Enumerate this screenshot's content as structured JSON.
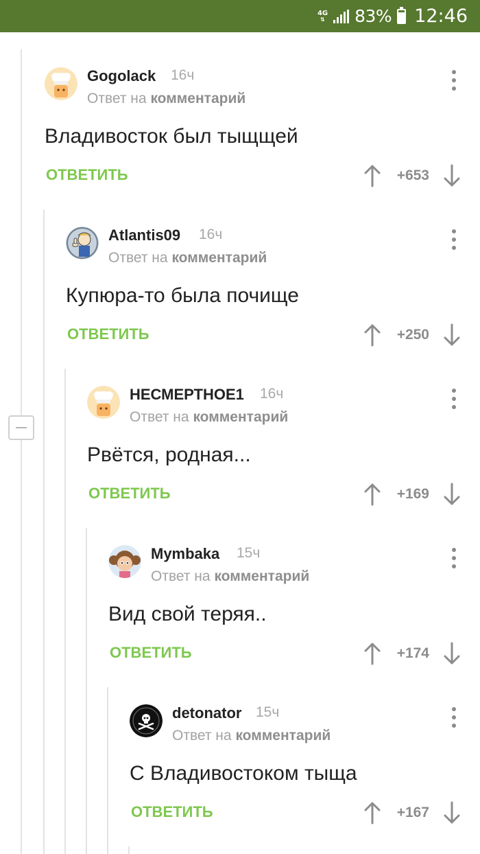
{
  "status_bar": {
    "network": "4G",
    "battery_percent": "83%",
    "battery_level": 0.83,
    "time": "12:46"
  },
  "reply_to_prefix": "Ответ на",
  "reply_to_target": "комментарий",
  "reply_label": "ОТВЕТИТЬ",
  "icons": {
    "upvote": "arrow-up-icon",
    "downvote": "arrow-down-icon",
    "menu": "more-vertical-icon",
    "collapse": "minus-icon"
  },
  "colors": {
    "status_bar": "#56782f",
    "reply_green": "#7ec84e",
    "thread_line": "#e2e2e2"
  },
  "comments": [
    {
      "author": "Gogolack",
      "time": "16ч",
      "text": "Владивосток был тыщщей",
      "rating": "+653",
      "avatar": "chef-hat-avatar"
    },
    {
      "author": "Atlantis09",
      "time": "16ч",
      "text": "Купюра-то была почище",
      "rating": "+250",
      "avatar": "vault-boy-avatar"
    },
    {
      "author": "НЕСМЕРТНОЕ1",
      "time": "16ч",
      "text": "Рвётся, родная...",
      "rating": "+169",
      "avatar": "chef-hat-avatar"
    },
    {
      "author": "Mymbaka",
      "time": "15ч",
      "text": "Вид свой теряя..",
      "rating": "+174",
      "avatar": "cartoon-girl-avatar"
    },
    {
      "author": "detonator",
      "time": "15ч",
      "text": "С Владивостоком тыща",
      "rating": "+167",
      "avatar": "skull-crossbones-avatar"
    }
  ]
}
